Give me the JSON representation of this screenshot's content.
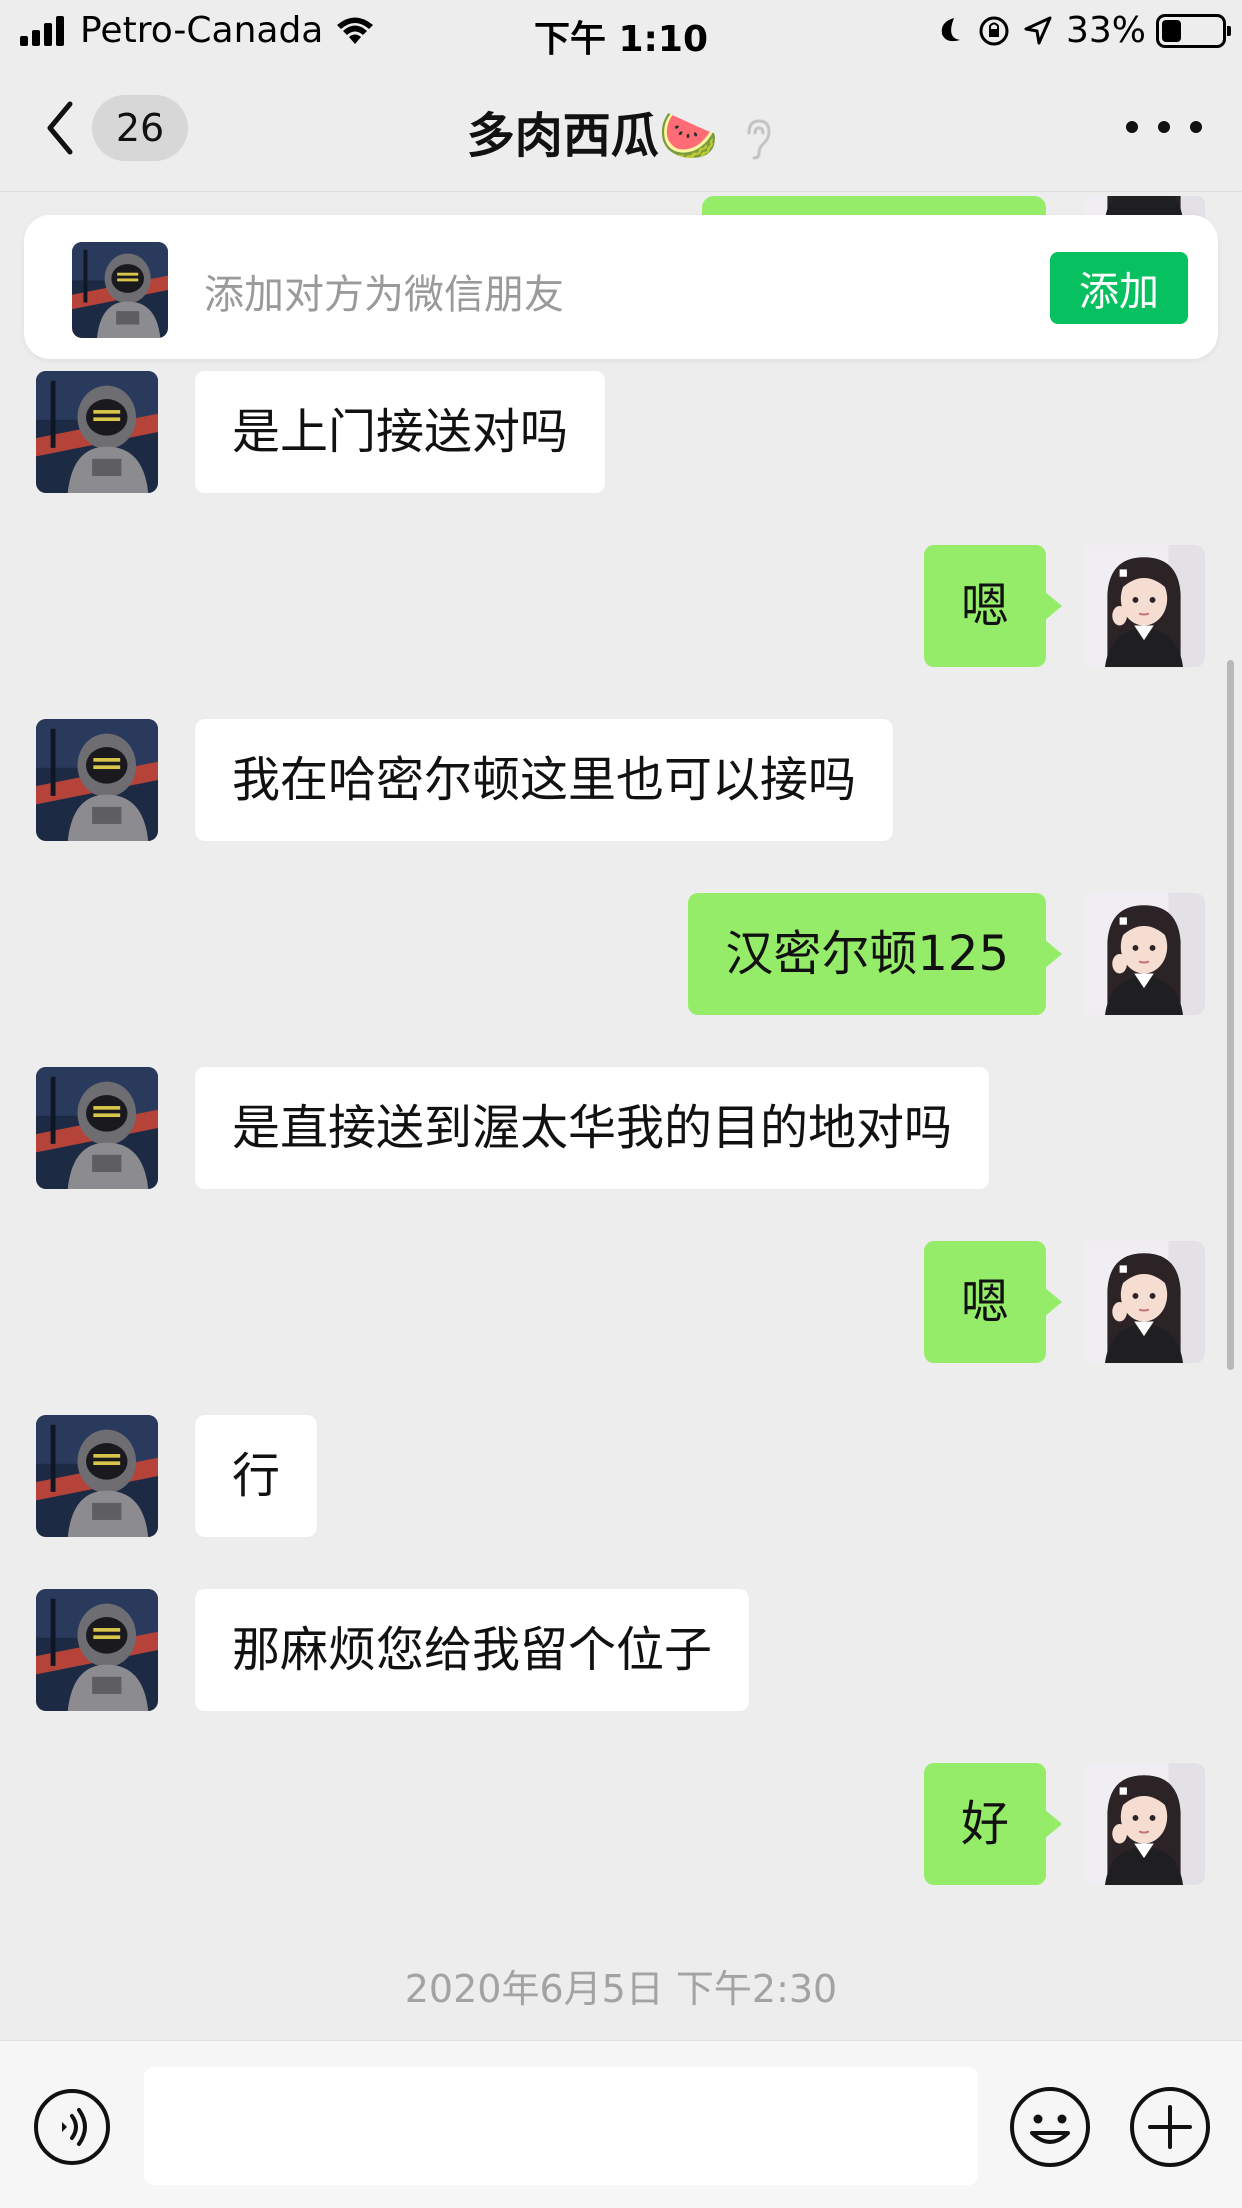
{
  "status_bar": {
    "carrier": "Petro-Canada",
    "time": "下午 1:10",
    "battery": "33%",
    "battery_level": 0.33
  },
  "nav": {
    "unread_count": "26",
    "title": "多肉西瓜🍉"
  },
  "add_friend": {
    "text": "添加对方为微信朋友",
    "button_label": "添加"
  },
  "messages": [
    {
      "from": "contact",
      "text": "是上门接送对吗"
    },
    {
      "from": "me",
      "text": "嗯"
    },
    {
      "from": "contact",
      "text": "我在哈密尔顿这里也可以接吗"
    },
    {
      "from": "me",
      "text": "汉密尔顿125"
    },
    {
      "from": "contact",
      "text": "是直接送到渥太华我的目的地对吗"
    },
    {
      "from": "me",
      "text": "嗯"
    },
    {
      "from": "contact",
      "text": "行"
    },
    {
      "from": "contact",
      "text": "那麻烦您给我留个位子"
    },
    {
      "from": "me",
      "text": "好"
    }
  ],
  "timestamp": "2020年6月5日 下午2:30",
  "colors": {
    "background": "#ededed",
    "outgoing_bubble": "#95ec69",
    "incoming_bubble": "#ffffff",
    "accent": "#07c160"
  }
}
